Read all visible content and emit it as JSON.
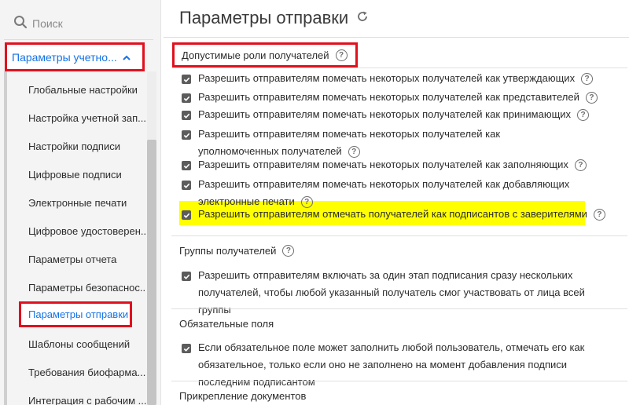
{
  "search": {
    "placeholder": "Поиск"
  },
  "sidebar": {
    "section_label": "Параметры учетно...",
    "items": [
      {
        "label": "Глобальные настройки"
      },
      {
        "label": "Настройка учетной зап..."
      },
      {
        "label": "Настройки подписи"
      },
      {
        "label": "Цифровые подписи"
      },
      {
        "label": "Электронные печати"
      },
      {
        "label": "Цифровое удостоверен..."
      },
      {
        "label": "Параметры отчета"
      },
      {
        "label": "Параметры безопаснос..."
      },
      {
        "label": "Параметры отправки"
      },
      {
        "label": "Шаблоны сообщений"
      },
      {
        "label": "Требования биофарма..."
      },
      {
        "label": "Интеграция с рабочим ..."
      }
    ],
    "active_index": 8
  },
  "main": {
    "title": "Параметры отправки",
    "sections": [
      {
        "title": "Допустимые роли получателей",
        "options": [
          {
            "text": "Разрешить отправителям помечать некоторых получателей как утверждающих",
            "checked": true
          },
          {
            "text": "Разрешить отправителям помечать некоторых получателей как представителей",
            "checked": true
          },
          {
            "text": "Разрешить отправителям помечать некоторых получателей как принимающих",
            "checked": true
          },
          {
            "text": "Разрешить отправителям помечать некоторых получателей как уполномоченных получателей",
            "checked": true
          },
          {
            "text": "Разрешить отправителям помечать некоторых получателей как заполняющих",
            "checked": true
          },
          {
            "text": "Разрешить отправителям помечать некоторых получателей как добавляющих электронные печати",
            "checked": true
          },
          {
            "text": "Разрешить отправителям отмечать получателей как подписантов с заверителями",
            "checked": true
          }
        ]
      },
      {
        "title": "Группы получателей",
        "options": [
          {
            "text": "Разрешить отправителям включать за один этап подписания сразу нескольких получателей, чтобы любой указанный получатель смог участвовать от лица всей группы",
            "checked": true
          }
        ]
      },
      {
        "title": "Обязательные поля",
        "options": [
          {
            "text": "Если обязательное поле может заполнить любой пользователь, отмечать его как обязательное, только если оно не заполнено на момент добавления подписи последним подписантом",
            "checked": true
          }
        ]
      },
      {
        "title": "Прикрепление документов"
      }
    ]
  },
  "colors": {
    "accent": "#1473e6",
    "annotation_red": "#e0111f",
    "highlight": "#ffff00"
  },
  "icons": {
    "search": "search-icon",
    "chevron": "chevron-up-icon",
    "refresh": "refresh-icon",
    "help": "help-icon",
    "check": "checkbox-checked-icon"
  }
}
